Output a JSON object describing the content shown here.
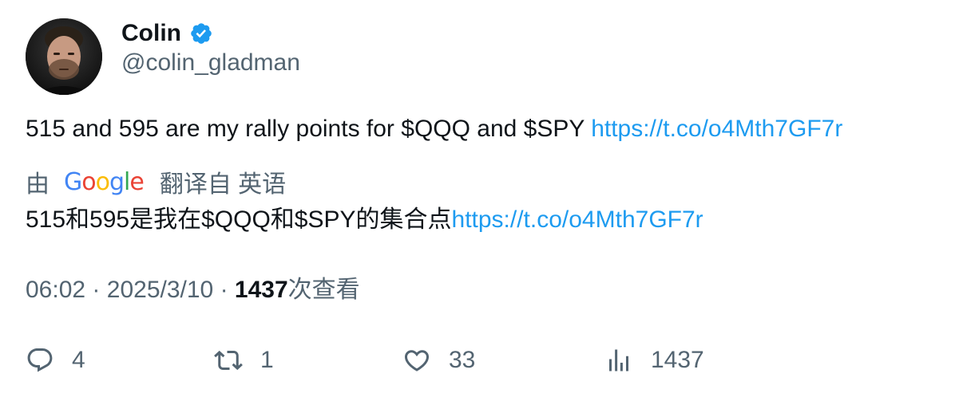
{
  "author": {
    "display_name": "Colin",
    "handle": "@colin_gladman",
    "verified_icon": "verified-badge-icon",
    "verified_color": "#1d9bf0"
  },
  "tweet": {
    "text": "515 and 595 are my rally points for $QQQ and $SPY ",
    "link": "https://t.co/o4Mth7GF7r"
  },
  "translation": {
    "prefix": "由",
    "provider": "Google",
    "suffix": "翻译自 英语",
    "text": "515和595是我在$QQQ和$SPY的集合点",
    "link": "https://t.co/o4Mth7GF7r"
  },
  "meta": {
    "time": "06:02",
    "separator": "·",
    "date": "2025/3/10",
    "views_count": "1437",
    "views_label": "次查看"
  },
  "actions": {
    "replies": "4",
    "retweets": "1",
    "likes": "33",
    "views": "1437"
  },
  "colors": {
    "text": "#0f1419",
    "secondary": "#536471",
    "link": "#1d9bf0"
  }
}
